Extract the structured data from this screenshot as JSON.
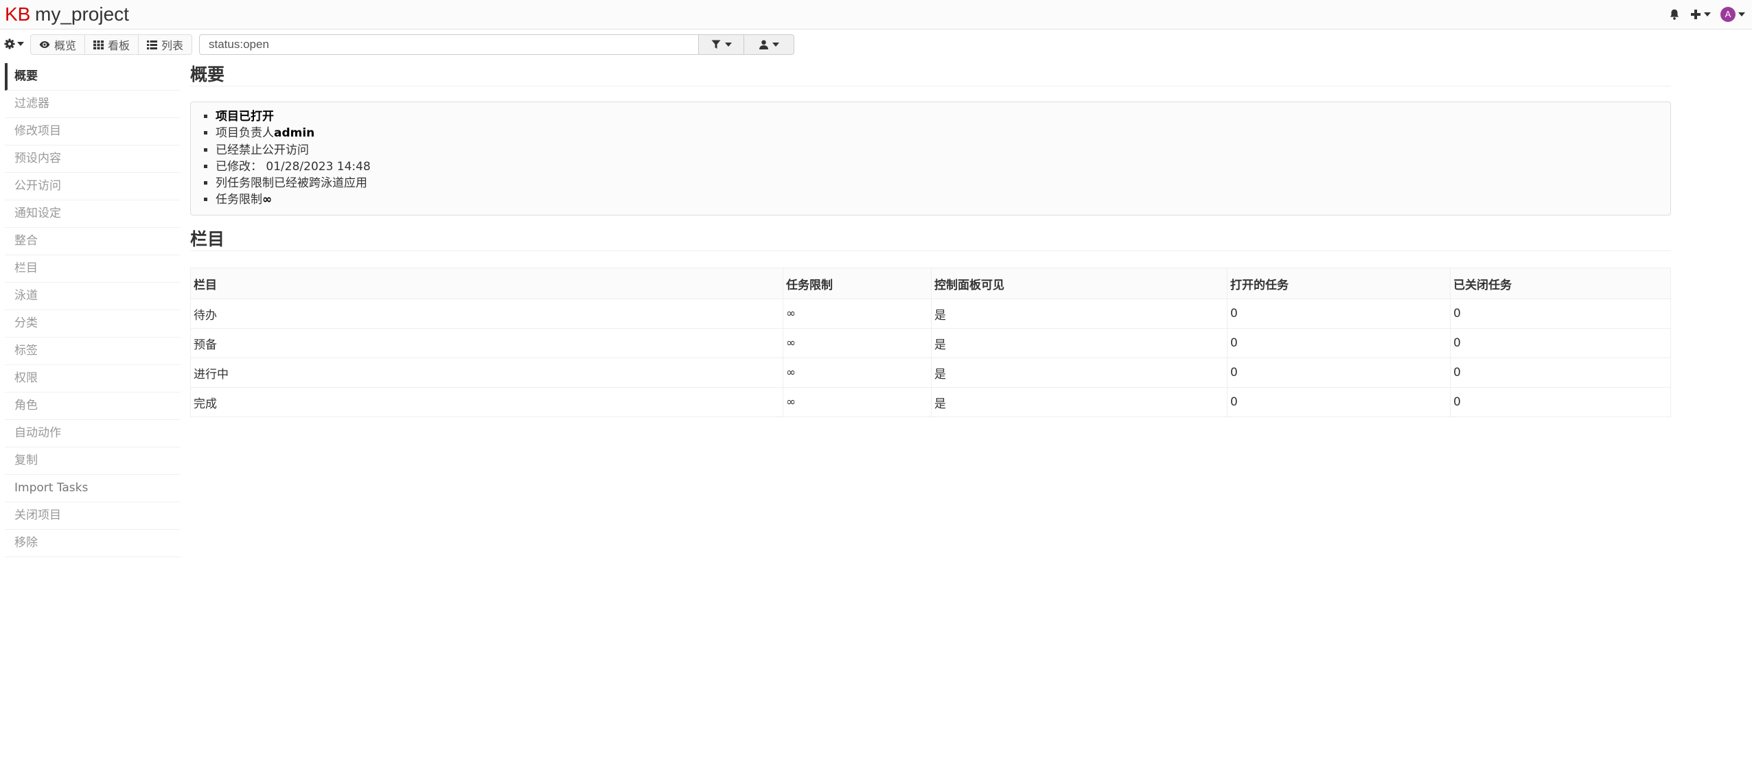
{
  "header": {
    "logo": "KB",
    "project_title": "my_project",
    "avatar_letter": "A"
  },
  "toolbar": {
    "views": [
      {
        "label": "概览",
        "icon": "eye-icon"
      },
      {
        "label": "看板",
        "icon": "grid-icon"
      },
      {
        "label": "列表",
        "icon": "list-icon"
      }
    ],
    "search_value": "status:open"
  },
  "sidebar": {
    "items": [
      {
        "label": "概要",
        "active": true
      },
      {
        "label": "过滤器"
      },
      {
        "label": "修改项目"
      },
      {
        "label": "预设内容"
      },
      {
        "label": "公开访问"
      },
      {
        "label": "通知设定"
      },
      {
        "label": "整合"
      },
      {
        "label": "栏目"
      },
      {
        "label": "泳道"
      },
      {
        "label": "分类"
      },
      {
        "label": "标签"
      },
      {
        "label": "权限"
      },
      {
        "label": "角色"
      },
      {
        "label": "自动动作"
      },
      {
        "label": "复制"
      },
      {
        "label": "Import Tasks"
      },
      {
        "label": "关闭项目"
      },
      {
        "label": "移除"
      }
    ]
  },
  "summary": {
    "title": "概要",
    "opened": "项目已打开",
    "owner_prefix": "项目负责人",
    "owner": "admin",
    "public_access": "已经禁止公开访问",
    "modified_label": "已修改：",
    "modified_value": "01/28/2023 14:48",
    "column_limit_note": "列任务限制已经被跨泳道应用",
    "task_limit_label": "任务限制",
    "task_limit_value": "∞"
  },
  "columns": {
    "title": "栏目",
    "headers": [
      "栏目",
      "任务限制",
      "控制面板可见",
      "打开的任务",
      "已关闭任务"
    ],
    "rows": [
      [
        "待办",
        "∞",
        "是",
        "0",
        "0"
      ],
      [
        "预备",
        "∞",
        "是",
        "0",
        "0"
      ],
      [
        "进行中",
        "∞",
        "是",
        "0",
        "0"
      ],
      [
        "完成",
        "∞",
        "是",
        "0",
        "0"
      ]
    ]
  }
}
